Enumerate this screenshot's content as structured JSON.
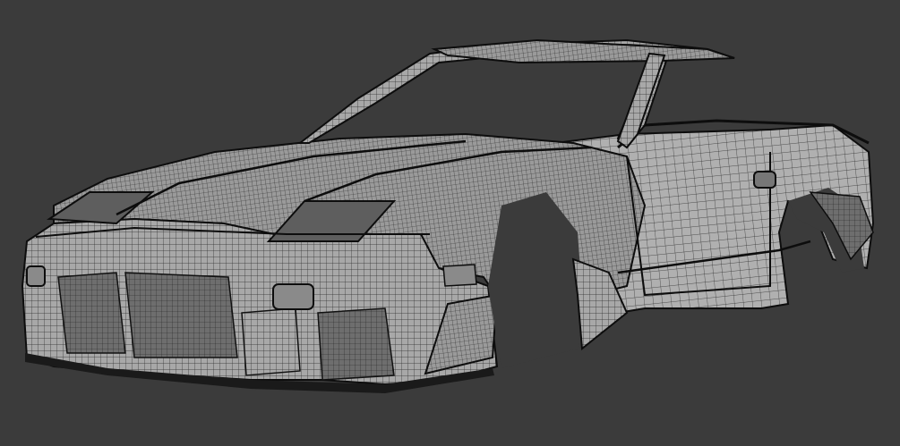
{
  "viewport": {
    "background": "#3b3b3b"
  },
  "model": {
    "subject": "car-body-wireframe",
    "shading": "grey-clay-with-wireframe",
    "body_color": "#a6a6a6",
    "wire_color": "#2a2a2a",
    "edge_color": "#0d0d0d"
  }
}
